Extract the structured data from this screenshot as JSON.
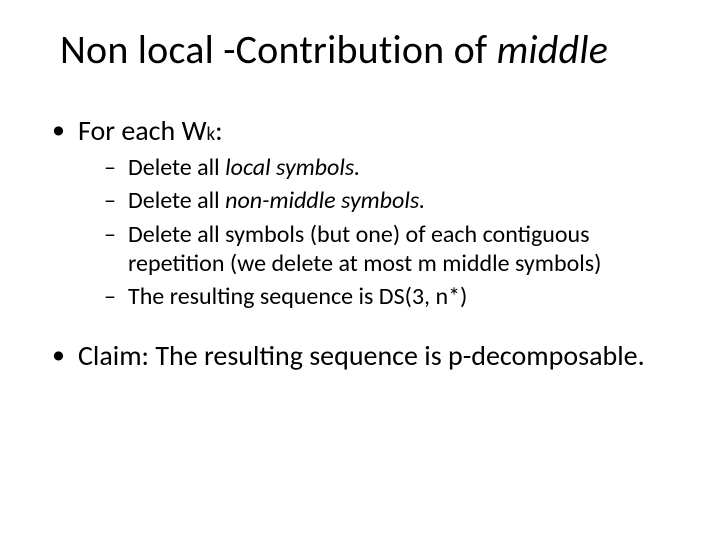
{
  "title_pre": "Non local -Contribution of ",
  "title_ital": "middle",
  "b1_pre": "For each W",
  "b1_sub": "k",
  "b1_post": ":",
  "s1_pre": "Delete all ",
  "s1_ital": "local symbols.",
  "s2_pre": "Delete all ",
  "s2_ital": "non-middle symbols.",
  "s3": "Delete all symbols (but one) of each contiguous repetition (we delete at most m middle symbols)",
  "s4": "The resulting sequence is DS(3, n*)",
  "b2": "Claim: The resulting sequence is p-decomposable."
}
